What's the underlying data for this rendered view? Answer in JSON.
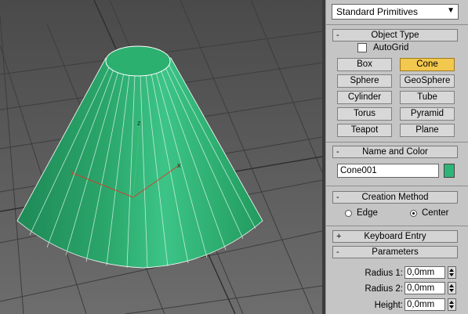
{
  "viewport": {
    "object_color": "#2fb477",
    "axis_x_color": "#c0392b",
    "axis_y_color": "#2aa050"
  },
  "panel": {
    "category_dropdown": "Standard Primitives",
    "object_type": {
      "title": "Object Type",
      "autogrid_label": "AutoGrid",
      "buttons": [
        "Box",
        "Cone",
        "Sphere",
        "GeoSphere",
        "Cylinder",
        "Tube",
        "Torus",
        "Pyramid",
        "Teapot",
        "Plane"
      ],
      "active": "Cone"
    },
    "name_and_color": {
      "title": "Name and Color",
      "name_value": "Cone001",
      "color": "#2fb477"
    },
    "creation_method": {
      "title": "Creation Method",
      "edge_label": "Edge",
      "center_label": "Center",
      "selected": "Center"
    },
    "keyboard_entry": {
      "title": "Keyboard Entry",
      "toggle": "+"
    },
    "parameters": {
      "title": "Parameters",
      "toggle": "-",
      "radius1_label": "Radius 1:",
      "radius1_value": "0,0mm",
      "radius2_label": "Radius 2:",
      "radius2_value": "0,0mm",
      "height_label": "Height:",
      "height_value": "0,0mm"
    },
    "rollout_toggles": {
      "object_type": "-",
      "name_and_color": "-",
      "creation_method": "-"
    }
  }
}
